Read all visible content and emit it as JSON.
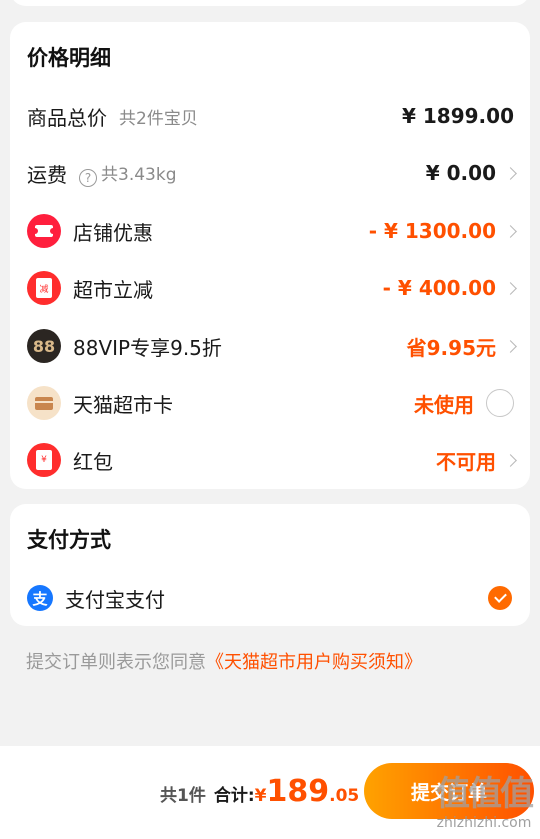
{
  "price_detail": {
    "title": "价格明细",
    "goods_total": {
      "label": "商品总价",
      "sub": "共2件宝贝",
      "value": "¥ 1899.00"
    },
    "shipping": {
      "label": "运费",
      "sub": "共3.43kg",
      "help_icon": "?",
      "value": "¥ 0.00"
    },
    "shop_discount": {
      "label": "店铺优惠",
      "value": "- ¥ 1300.00",
      "icon": "ticket-icon"
    },
    "market_discount": {
      "label": "超市立减",
      "value": "- ¥ 400.00",
      "icon": "envelope-icon",
      "icon_text": "减"
    },
    "vip_discount": {
      "label": "88VIP专享9.5折",
      "value": "省9.95元",
      "icon_text": "88"
    },
    "tmall_card": {
      "label": "天猫超市卡",
      "value": "未使用",
      "icon": "card-icon"
    },
    "red_packet": {
      "label": "红包",
      "value": "不可用",
      "icon": "red-packet-icon",
      "icon_text": "¥"
    }
  },
  "payment": {
    "title": "支付方式",
    "method": {
      "label": "支付宝支付",
      "icon_text": "支",
      "selected": true
    }
  },
  "agreement": {
    "text": "提交订单则表示您同意",
    "link": "《天猫超市用户购买须知》"
  },
  "bottom_bar": {
    "count": "共1件",
    "total_label": "合计:",
    "currency": "¥",
    "total_int": "189",
    "total_dec": ".05",
    "submit_label": "提交订单"
  },
  "watermark": {
    "logo": "值值值",
    "url": "zhizhizhi.com"
  },
  "colors": {
    "accent": "#ff5000",
    "button_start": "#ffa200",
    "button_end": "#ff5000",
    "alipay": "#1677ff"
  }
}
